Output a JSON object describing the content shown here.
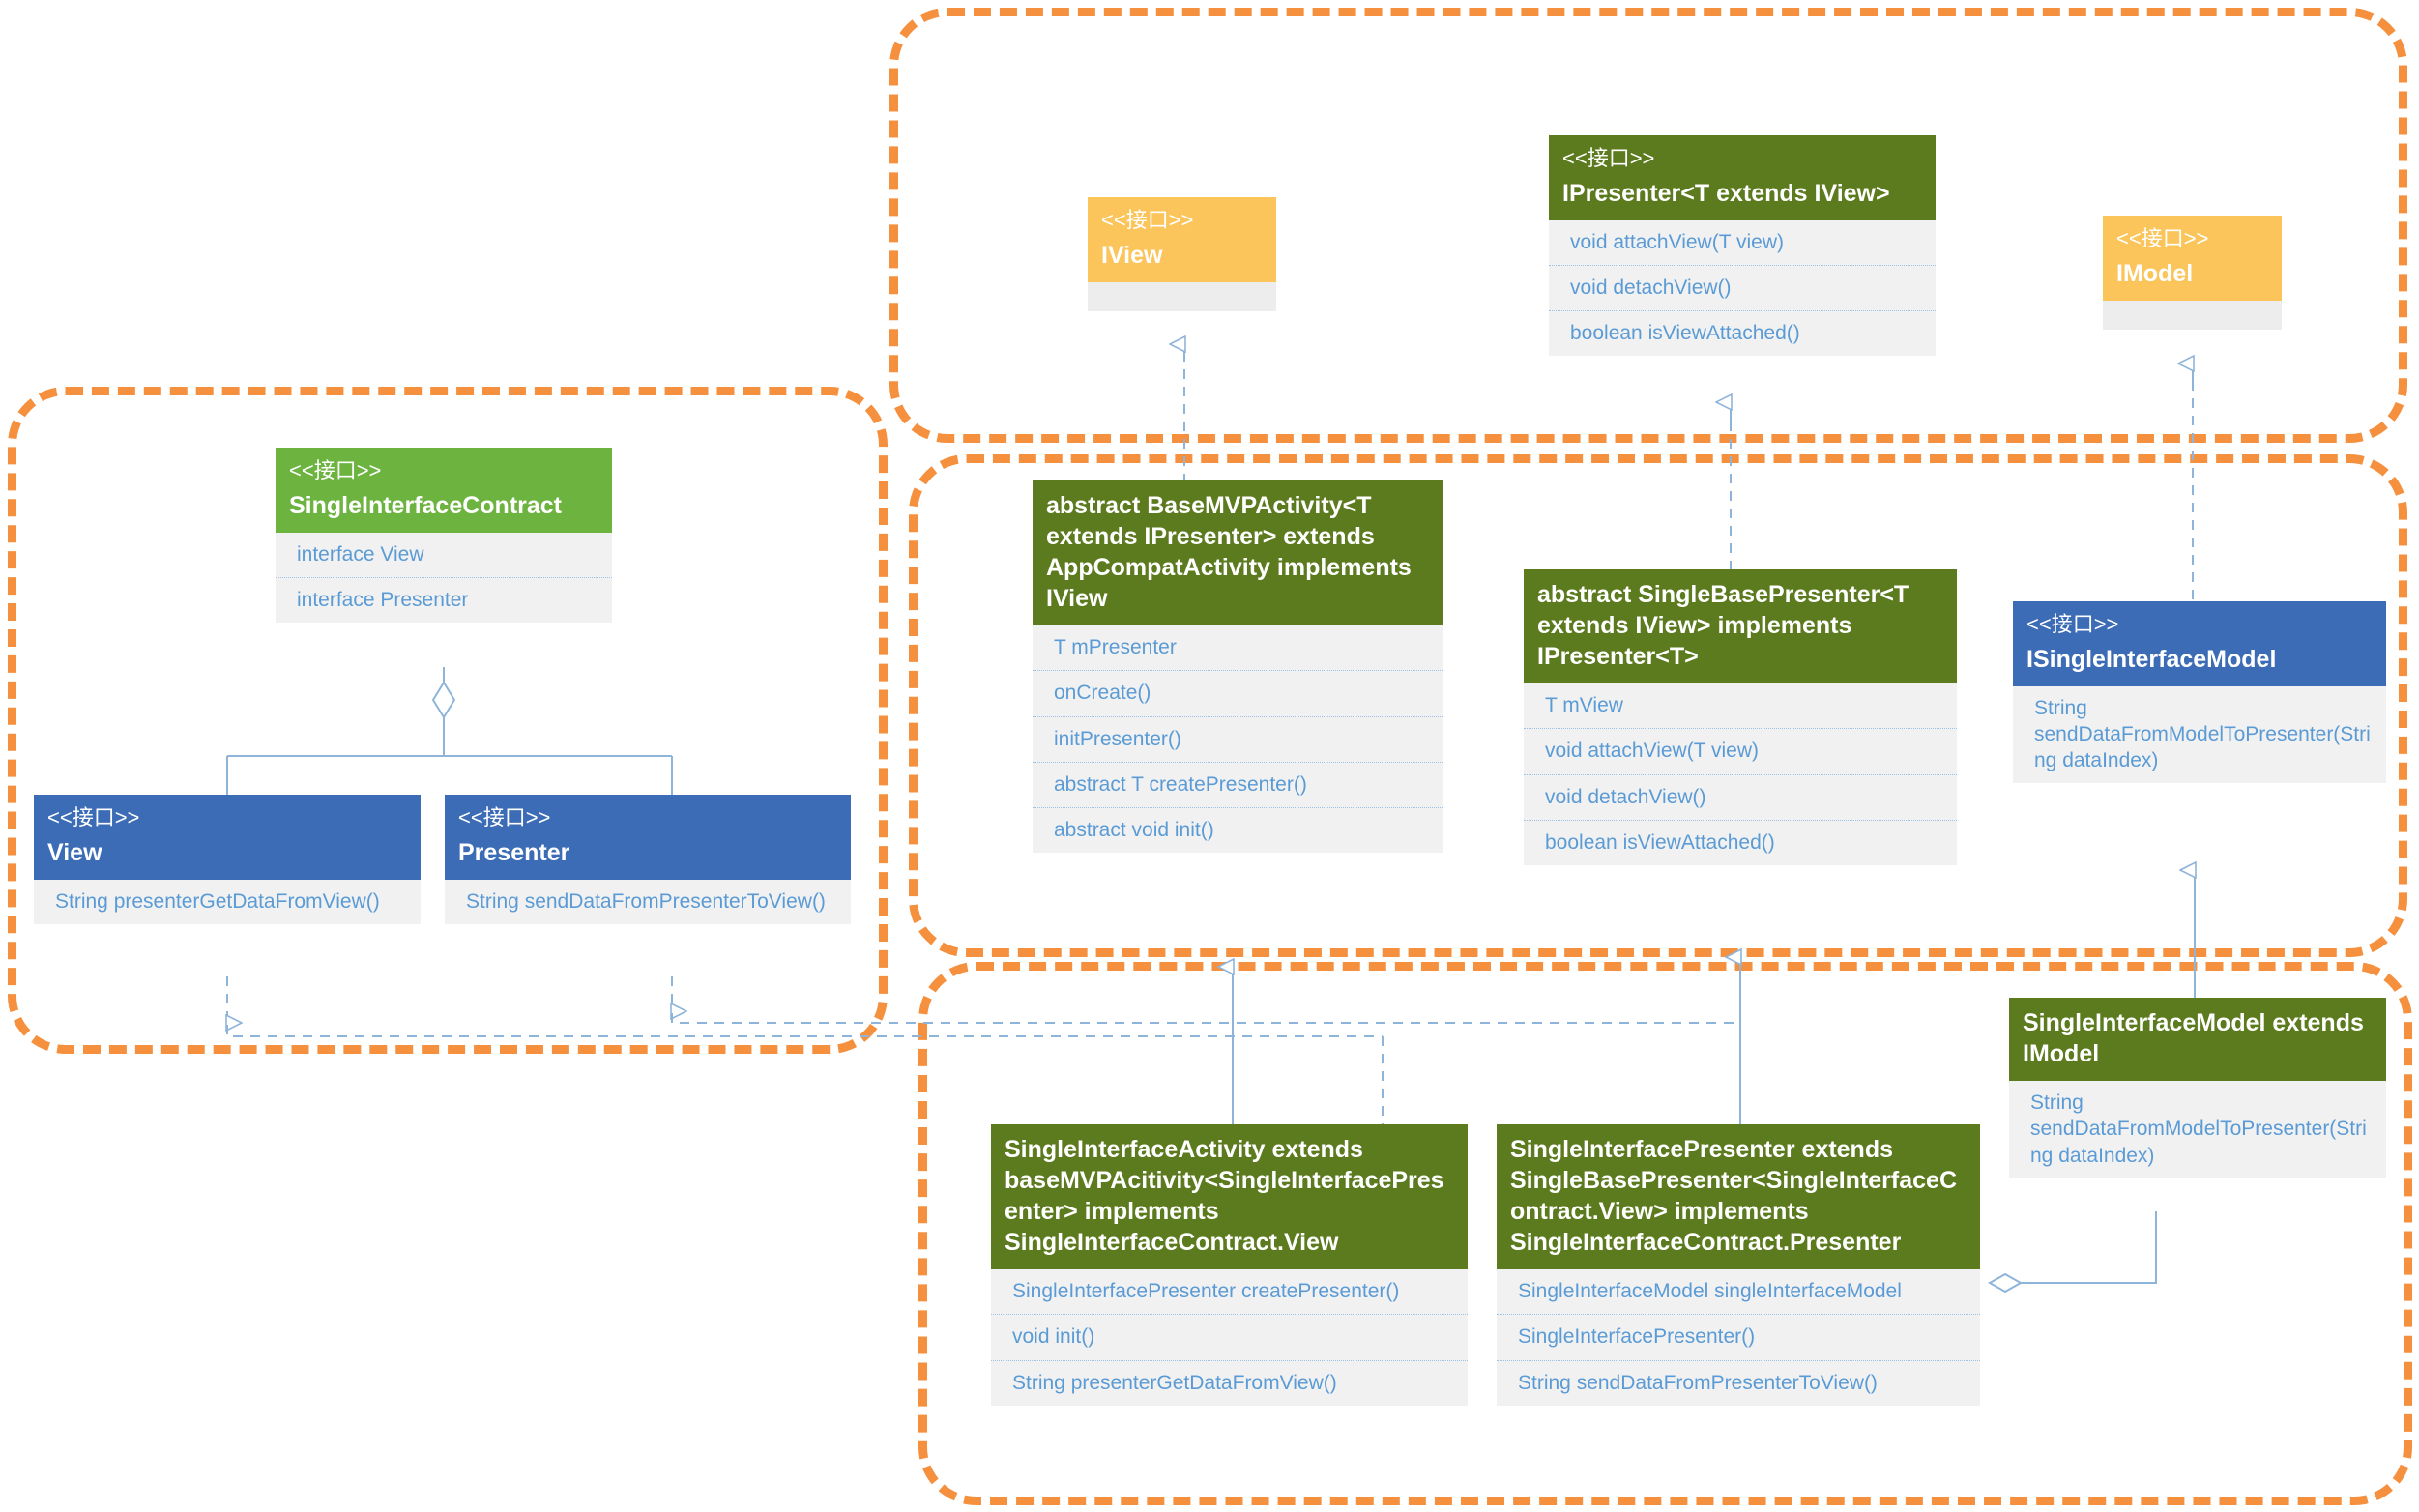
{
  "diagram": {
    "title": "Android MVP single-interface class diagram",
    "stereotype_label": "<<接口>>",
    "colors": {
      "group_frame": "#F5903E",
      "class_header_dark_green": "#5C7A1E",
      "class_header_light_green": "#6CB33F",
      "class_header_blue": "#3B6CB5",
      "class_header_amber": "#FBC55C",
      "member_text": "#5B9BD5",
      "member_bg": "#F1F1F1",
      "connector": "#8FB4D9"
    }
  },
  "classes": {
    "single_interface_contract": {
      "stereotype": "<<接口>>",
      "name": "SingleInterfaceContract",
      "members": [
        "interface View",
        "interface Presenter"
      ]
    },
    "view": {
      "stereotype": "<<接口>>",
      "name": "View",
      "members": [
        "String presenterGetDataFromView()"
      ]
    },
    "presenter": {
      "stereotype": "<<接口>>",
      "name": "Presenter",
      "members": [
        "String sendDataFromPresenterToView()"
      ]
    },
    "iview": {
      "stereotype": "<<接口>>",
      "name": "IView",
      "members": []
    },
    "ipresenter": {
      "stereotype": "<<接口>>",
      "name": "IPresenter<T extends IView>",
      "members": [
        "void attachView(T view)",
        "void detachView()",
        "boolean isViewAttached()"
      ]
    },
    "imodel": {
      "stereotype": "<<接口>>",
      "name": "IModel",
      "members": []
    },
    "base_mvp_activity": {
      "stereotype": "",
      "name": "abstract BaseMVPActivity<T extends IPresenter> extends AppCompatActivity implements IView",
      "members": [
        "T mPresenter",
        "onCreate()",
        "initPresenter()",
        "abstract T createPresenter()",
        "abstract void init()"
      ]
    },
    "single_base_presenter": {
      "stereotype": "",
      "name": "abstract SingleBasePresenter<T extends IView> implements IPresenter<T>",
      "members": [
        "T mView",
        "void attachView(T view)",
        "void detachView()",
        "boolean isViewAttached()"
      ]
    },
    "isingle_interface_model": {
      "stereotype": "<<接口>>",
      "name": "ISingleInterfaceModel",
      "members": [
        "String sendDataFromModelToPresenter(String dataIndex)"
      ]
    },
    "single_interface_model": {
      "stereotype": "",
      "name": "SingleInterfaceModel extends IModel",
      "members": [
        "String sendDataFromModelToPresenter(String dataIndex)"
      ]
    },
    "single_interface_activity": {
      "stereotype": "",
      "name": "SingleInterfaceActivity extends baseMVPAcitivity<SingleInterfacePresenter> implements SingleInterfaceContract.View",
      "members": [
        "SingleInterfacePresenter createPresenter()",
        "void init()",
        "String presenterGetDataFromView()"
      ]
    },
    "single_interface_presenter": {
      "stereotype": "",
      "name": "SingleInterfacePresenter extends SingleBasePresenter<SingleInterfaceContract.View> implements SingleInterfaceContract.Presenter",
      "members": [
        "SingleInterfaceModel singleInterfaceModel",
        "SingleInterfacePresenter()",
        "String sendDataFromPresenterToView()"
      ]
    }
  }
}
